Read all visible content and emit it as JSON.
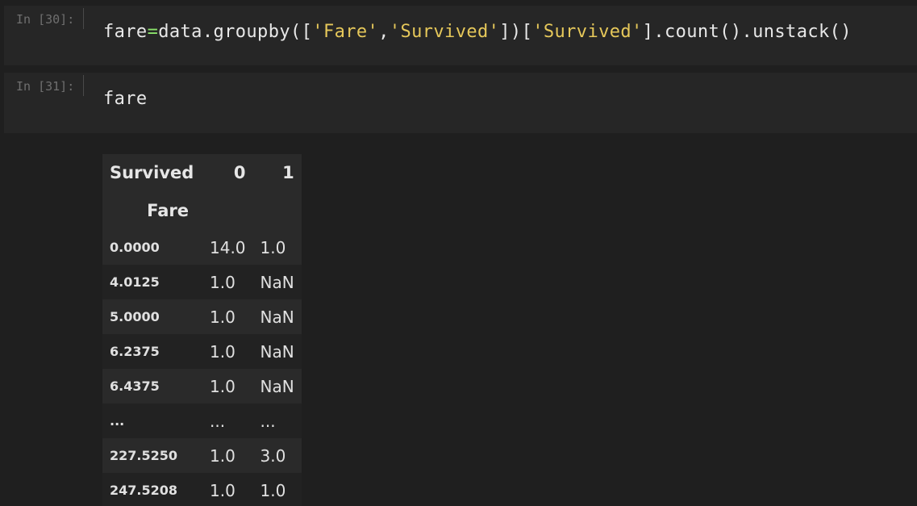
{
  "cells": [
    {
      "prompt": "In [30]:",
      "code": {
        "t1": "fare",
        "op": "=",
        "t2": "data.groupby([",
        "s1": "'Fare'",
        "t3": ",",
        "s2": "'Survived'",
        "t4": "])[",
        "s3": "'Survived'",
        "t5": "].count().unstack()"
      }
    },
    {
      "prompt": "In [31]:",
      "code": {
        "t1": "fare"
      }
    }
  ],
  "table": {
    "columns_name": "Survived",
    "col0": "0",
    "col1": "1",
    "index_name": "Fare",
    "rows": [
      {
        "index": "0.0000",
        "v0": "14.0",
        "v1": "1.0"
      },
      {
        "index": "4.0125",
        "v0": "1.0",
        "v1": "NaN"
      },
      {
        "index": "5.0000",
        "v0": "1.0",
        "v1": "NaN"
      },
      {
        "index": "6.2375",
        "v0": "1.0",
        "v1": "NaN"
      },
      {
        "index": "6.4375",
        "v0": "1.0",
        "v1": "NaN"
      },
      {
        "index": "...",
        "v0": "...",
        "v1": "..."
      },
      {
        "index": "227.5250",
        "v0": "1.0",
        "v1": "3.0"
      },
      {
        "index": "247.5208",
        "v0": "1.0",
        "v1": "1.0"
      }
    ]
  },
  "colors": {
    "background": "#1f1f1f",
    "cell": "#262626",
    "operator": "#8be36b",
    "string": "#e6c85a"
  }
}
